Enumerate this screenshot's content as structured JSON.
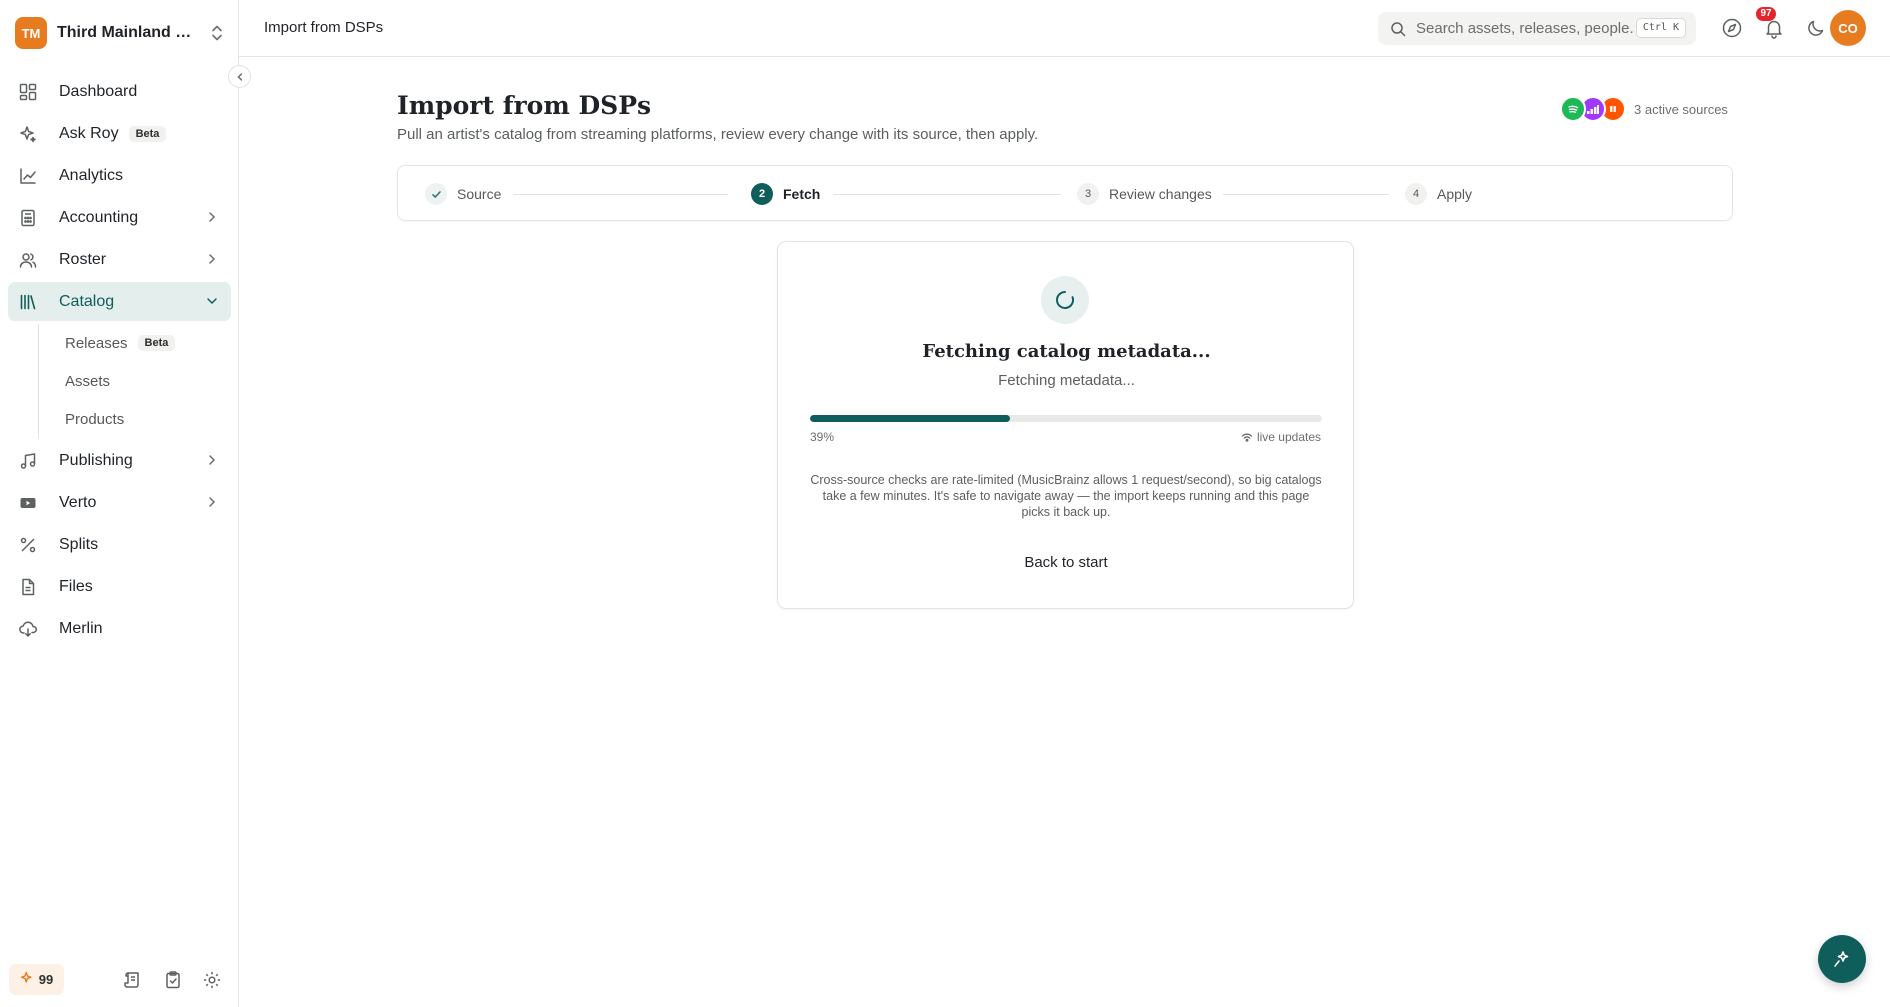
{
  "org": {
    "initials": "TM",
    "name": "Third Mainland Records"
  },
  "sidebar": {
    "items": [
      {
        "label": "Dashboard",
        "icon": "dashboard-icon"
      },
      {
        "label": "Ask Roy",
        "badge": "Beta",
        "icon": "sparkle-icon"
      },
      {
        "label": "Analytics",
        "icon": "line-chart-icon"
      },
      {
        "label": "Accounting",
        "icon": "calculator-icon",
        "expandable": true
      },
      {
        "label": "Roster",
        "icon": "users-icon",
        "expandable": true
      },
      {
        "label": "Catalog",
        "icon": "library-icon",
        "expanded": true,
        "active": true
      },
      {
        "label": "Publishing",
        "icon": "music-note-icon",
        "expandable": true
      },
      {
        "label": "Verto",
        "icon": "video-icon",
        "expandable": true
      },
      {
        "label": "Splits",
        "icon": "percent-icon"
      },
      {
        "label": "Files",
        "icon": "file-icon"
      },
      {
        "label": "Merlin",
        "icon": "cloud-download-icon"
      }
    ],
    "catalog_sub": [
      {
        "label": "Releases",
        "badge": "Beta"
      },
      {
        "label": "Assets"
      },
      {
        "label": "Products"
      }
    ],
    "credits": "99"
  },
  "topbar": {
    "crumb": "Import from DSPs",
    "search_placeholder": "Search assets, releases, people...",
    "shortcut": "Ctrl K",
    "notifications": "97",
    "avatar": "CO"
  },
  "page": {
    "title": "Import from DSPs",
    "subtitle": "Pull an artist's catalog from streaming platforms, review every change with its source, then apply.",
    "sources_label": "3 active sources",
    "source_colors": [
      "#1db954",
      "#a238ff",
      "#ff5500"
    ]
  },
  "steps": [
    {
      "num": "1",
      "label": "Source",
      "state": "done"
    },
    {
      "num": "2",
      "label": "Fetch",
      "state": "current"
    },
    {
      "num": "3",
      "label": "Review changes",
      "state": "pending"
    },
    {
      "num": "4",
      "label": "Apply",
      "state": "pending"
    }
  ],
  "card": {
    "title": "Fetching catalog metadata...",
    "status": "Fetching metadata...",
    "progress": 39,
    "progress_label": "39%",
    "live_label": "live updates",
    "note": "Cross-source checks are rate-limited (MusicBrainz allows 1 request/second), so big catalogs take a few minutes. It's safe to navigate away — the import keeps running and this page picks it back up.",
    "back_button": "Back to start"
  },
  "colors": {
    "brand": "#0f5e5c",
    "accent": "#e67b1f",
    "alert": "#e5242c"
  }
}
